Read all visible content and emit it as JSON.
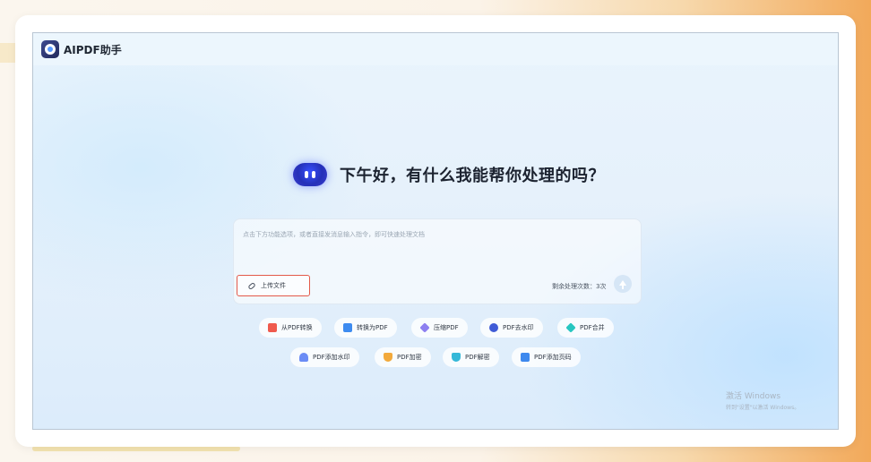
{
  "app": {
    "title": "AIPDF助手",
    "logo_icon": "aipdf-logo-icon"
  },
  "greeting": {
    "text": "下午好，有什么我能帮你处理的吗？",
    "icon": "bot-icon"
  },
  "input": {
    "placeholder": "点击下方功能选项，或者直接发消息输入指令，即可快速处理文档",
    "upload_label": "上传文件",
    "remaining_label": "剩余处理次数：3次"
  },
  "actions": {
    "row1": [
      {
        "label": "从PDF转换",
        "icon": "pdf-convert-from-icon"
      },
      {
        "label": "转换为PDF",
        "icon": "convert-to-pdf-icon"
      },
      {
        "label": "压缩PDF",
        "icon": "compress-pdf-icon"
      },
      {
        "label": "PDF去水印",
        "icon": "remove-watermark-icon"
      },
      {
        "label": "PDF合并",
        "icon": "merge-pdf-icon"
      }
    ],
    "row2": [
      {
        "label": "PDF添加水印",
        "icon": "add-watermark-icon"
      },
      {
        "label": "PDF加密",
        "icon": "encrypt-pdf-icon"
      },
      {
        "label": "PDF解密",
        "icon": "decrypt-pdf-icon"
      },
      {
        "label": "PDF添加页码",
        "icon": "add-page-number-icon"
      }
    ]
  },
  "watermark": {
    "line1": "激活 Windows",
    "line2": "转到\"设置\"以激活 Windows。"
  },
  "colors": {
    "accent_upload_border": "#e35a4a",
    "bot_blue": "#2530b8"
  }
}
